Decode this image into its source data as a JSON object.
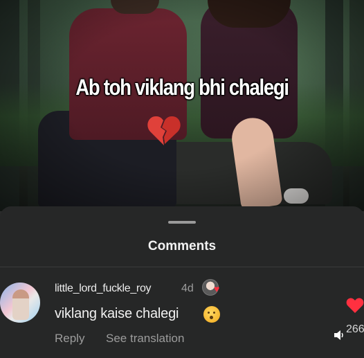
{
  "video": {
    "caption": "Ab toh viklang bhi chalegi",
    "caption_emoji": "broken-heart"
  },
  "comments_sheet": {
    "title": "Comments",
    "comment": {
      "username": "little_lord_fuckle_roy",
      "time": "4d",
      "text": "viklang kaise chalegi",
      "emoji": "raised-eyebrow-face",
      "reply_label": "Reply",
      "translate_label": "See translation",
      "like_count": "266"
    }
  },
  "colors": {
    "sheet_background": "#262727",
    "like_red": "#ff3040",
    "meta_gray": "#9c9c9c"
  }
}
